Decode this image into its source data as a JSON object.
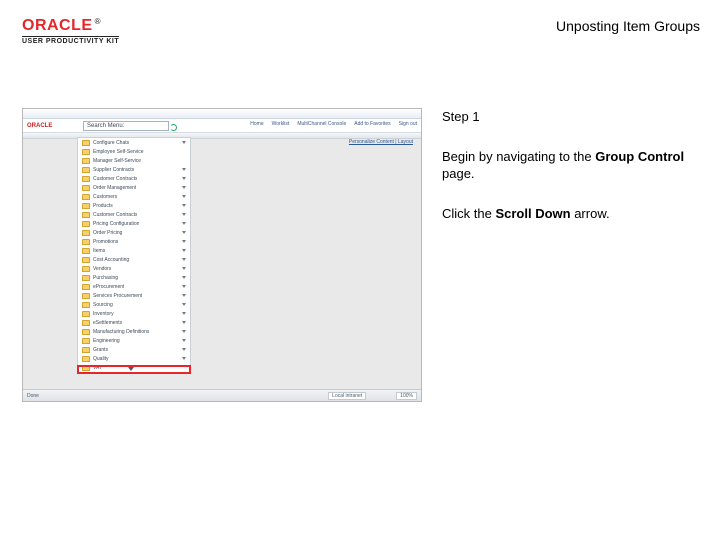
{
  "header": {
    "brand": "ORACLE",
    "trademark": "®",
    "subbrand": "USER PRODUCTIVITY KIT",
    "title": "Unposting Item Groups"
  },
  "instructions": {
    "step_label": "Step 1",
    "p1_a": "Begin by navigating to the ",
    "p1_b": "Group Control",
    "p1_c": " page.",
    "p2_a": "Click the ",
    "p2_b": "Scroll Down",
    "p2_c": " arrow."
  },
  "screenshot": {
    "brand": "ORACLE",
    "search_label": "Search Menu:",
    "toolbar": [
      "Home",
      "Worklist",
      "MultiChannel Console",
      "Add to Favorites",
      "Sign out"
    ],
    "personalize": "Personalize Content | Layout",
    "tree": [
      {
        "label": "Configure Chats",
        "expandable": true
      },
      {
        "label": "Employee Self-Service",
        "expandable": false
      },
      {
        "label": "Manager Self-Service",
        "expandable": false
      },
      {
        "label": "Supplier Contracts",
        "expandable": true
      },
      {
        "label": "Customer Contracts",
        "expandable": true
      },
      {
        "label": "Order Management",
        "expandable": true
      },
      {
        "label": "Customers",
        "expandable": true
      },
      {
        "label": "Products",
        "expandable": true
      },
      {
        "label": "Customer Contracts",
        "expandable": true
      },
      {
        "label": "Pricing Configuration",
        "expandable": true
      },
      {
        "label": "Order Pricing",
        "expandable": true
      },
      {
        "label": "Promotions",
        "expandable": true
      },
      {
        "label": "Items",
        "expandable": true
      },
      {
        "label": "Cost Accounting",
        "expandable": true
      },
      {
        "label": "Vendors",
        "expandable": true
      },
      {
        "label": "Purchasing",
        "expandable": true
      },
      {
        "label": "eProcurement",
        "expandable": true
      },
      {
        "label": "Services Procurement",
        "expandable": true
      },
      {
        "label": "Sourcing",
        "expandable": true
      },
      {
        "label": "Inventory",
        "expandable": true
      },
      {
        "label": "eSettlements",
        "expandable": true
      },
      {
        "label": "Manufacturing Definitions",
        "expandable": true
      },
      {
        "label": "Engineering",
        "expandable": true
      },
      {
        "label": "Grants",
        "expandable": true
      },
      {
        "label": "Quality",
        "expandable": true
      },
      {
        "label": "VAT",
        "expandable": false
      }
    ],
    "status": {
      "left": "Done",
      "mid": "Local intranet",
      "zoom": "100%"
    }
  }
}
